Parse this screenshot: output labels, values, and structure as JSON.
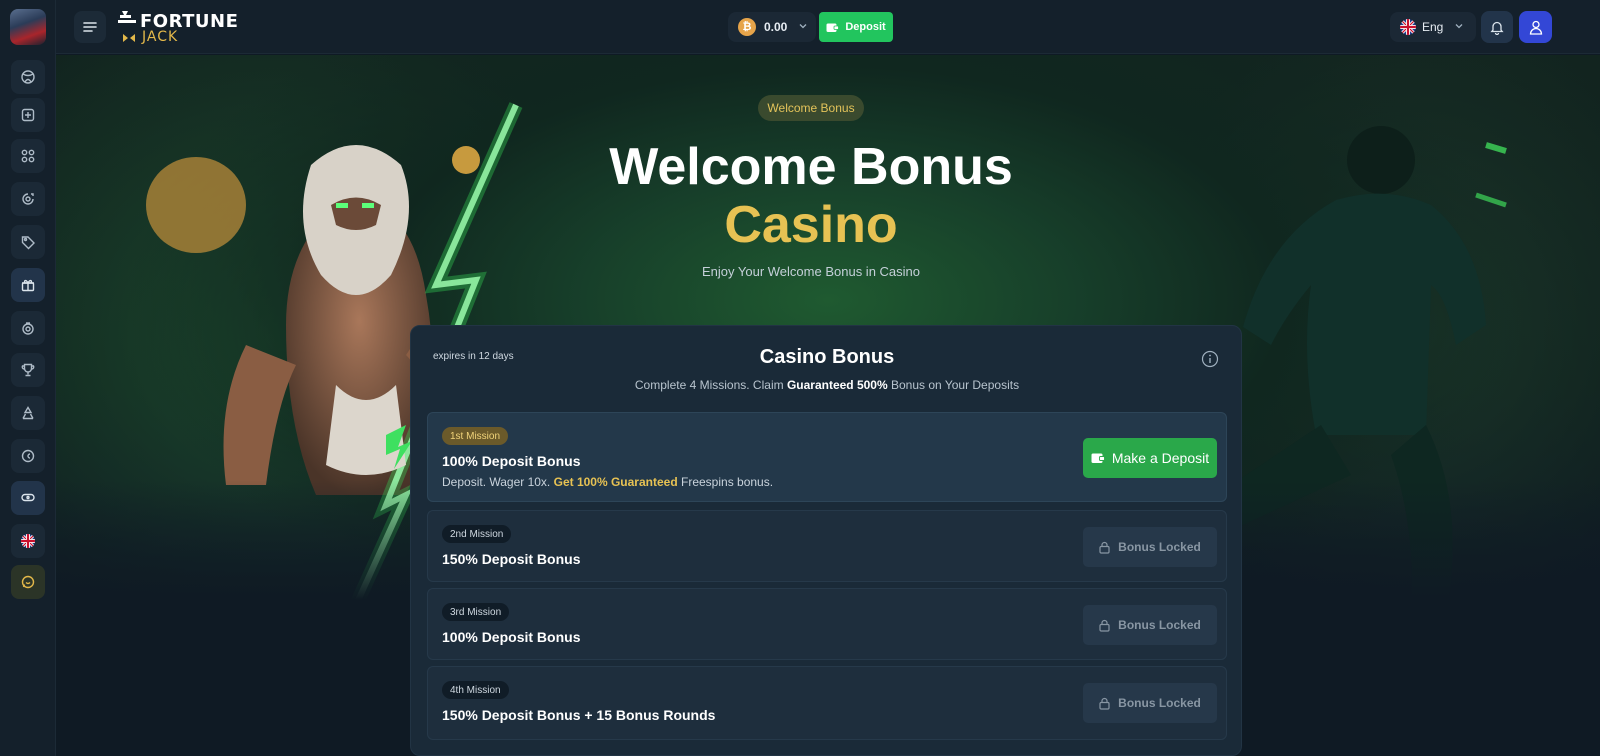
{
  "header": {
    "logo_top": "FORTUNE",
    "logo_bottom": "JACK",
    "balance": "0.00",
    "currency_icon": "bitcoin-icon",
    "deposit_label": "Deposit",
    "language": "Eng"
  },
  "sidebar": {
    "items": [
      {
        "icon": "sports-ball-icon"
      },
      {
        "icon": "casino-table-icon"
      },
      {
        "icon": "grid-icon"
      },
      {
        "icon": "chip-icon"
      },
      {
        "icon": "promo-tag-icon"
      },
      {
        "icon": "gift-icon",
        "active": true
      },
      {
        "icon": "bonus-icon"
      },
      {
        "icon": "trophy-icon"
      },
      {
        "icon": "recycle-icon"
      },
      {
        "icon": "crypto-icon"
      },
      {
        "icon": "gamepad-icon"
      },
      {
        "icon": "uk-flag-icon"
      },
      {
        "icon": "chat-icon"
      }
    ]
  },
  "hero": {
    "badge": "Welcome Bonus",
    "title": "Welcome Bonus",
    "subtitle": "Casino",
    "description": "Enjoy Your Welcome Bonus in Casino"
  },
  "card": {
    "expires": "expires in 12 days",
    "title": "Casino Bonus",
    "desc_prefix": "Complete 4 Missions. Claim ",
    "desc_bold": "Guaranteed 500%",
    "desc_suffix": " Bonus on Your Deposits",
    "missions": [
      {
        "tag": "1st Mission",
        "title": "100% Deposit Bonus",
        "detail_prefix": "Deposit. Wager 10x. ",
        "detail_highlight": "Get 100% Guaranteed",
        "detail_suffix": " Freespins bonus.",
        "button": "Make a Deposit"
      },
      {
        "tag": "2nd Mission",
        "title": "150% Deposit Bonus",
        "button": "Bonus Locked"
      },
      {
        "tag": "3rd Mission",
        "title": "100% Deposit Bonus",
        "button": "Bonus Locked"
      },
      {
        "tag": "4th Mission",
        "title": "150% Deposit Bonus + 15 Bonus Rounds",
        "button": "Bonus Locked"
      }
    ]
  },
  "colors": {
    "accent_green": "#22c55e",
    "gold": "#e7c253",
    "user_blue": "#3347d6"
  }
}
